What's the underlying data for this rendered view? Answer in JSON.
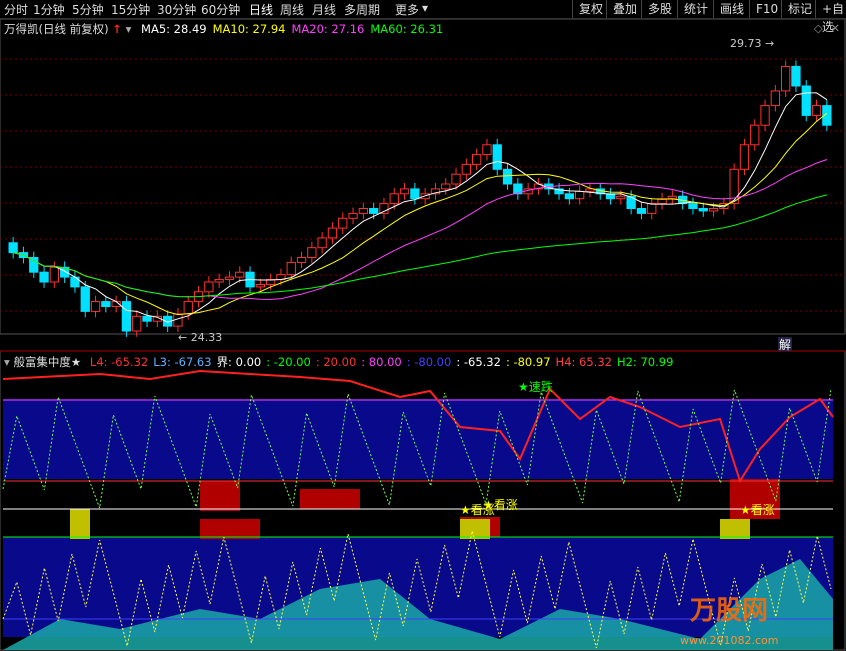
{
  "toolbar": {
    "periods": [
      "分时",
      "1分钟",
      "5分钟",
      "15分钟",
      "30分钟",
      "60分钟",
      "日线",
      "周线",
      "月线",
      "多周期",
      "更多"
    ],
    "active": "日线",
    "right_buttons": [
      "复权",
      "叠加",
      "多股",
      "统计",
      "画线",
      "F10",
      "标记",
      "+自选"
    ]
  },
  "main_chart": {
    "stock_title": "万得凯(日线 前复权)",
    "ma": [
      {
        "label": "MA5: 28.49",
        "color": "#ffffff"
      },
      {
        "label": "MA10: 27.94",
        "color": "#ffff00"
      },
      {
        "label": "MA20: 27.16",
        "color": "#ff40ff"
      },
      {
        "label": "MA60: 26.31",
        "color": "#00ff00"
      }
    ],
    "high_label": "29.73",
    "low_label": "24.33",
    "jie_label": "解",
    "icon_names": [
      "up-arrow-icon",
      "dropdown-icon",
      "diamond-icon",
      "close-icon"
    ]
  },
  "indicator": {
    "name": "般富集中度★",
    "params": [
      {
        "text": "L4: -65.32",
        "color": "#ff3030"
      },
      {
        "text": "L3: -67.63",
        "color": "#60b0ff"
      },
      {
        "text": "界: 0.00",
        "color": "#ffffff"
      },
      {
        "text": ": -20.00",
        "color": "#00ff00"
      },
      {
        "text": ": 20.00",
        "color": "#ff3030"
      },
      {
        "text": ": 80.00",
        "color": "#ff40ff"
      },
      {
        "text": ": -80.00",
        "color": "#4040ff"
      },
      {
        "text": ": -65.32",
        "color": "#ffffff"
      },
      {
        "text": ": -80.97",
        "color": "#ffff00"
      },
      {
        "text": "H4: 65.32",
        "color": "#ff4040"
      },
      {
        "text": "H2: 70.99",
        "color": "#00ff00"
      }
    ],
    "signals": [
      {
        "text": "速跌",
        "color": "#00ff00"
      },
      {
        "text": "看涨",
        "color": "#ffff00"
      },
      {
        "text": "看涨",
        "color": "#ffff00"
      },
      {
        "text": "看涨",
        "color": "#ffff00"
      }
    ]
  },
  "watermark": {
    "text": "万股网",
    "url": "www.201082.com"
  }
}
